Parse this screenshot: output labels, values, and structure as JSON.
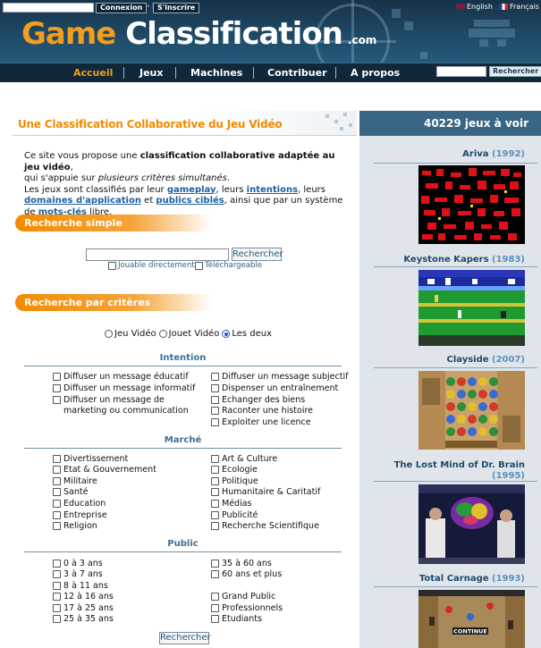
{
  "header": {
    "login_button": "Connexion",
    "signup_button": "S'inscrire",
    "separator": "-",
    "logo_game": "Game",
    "logo_classification": "Classification",
    "logo_com": ".com",
    "lang_en": "English",
    "lang_fr": "Français",
    "search_button": "Rechercher"
  },
  "nav": {
    "items": [
      "Accueil",
      "Jeux",
      "Machines",
      "Contribuer",
      "A propos"
    ]
  },
  "main": {
    "title": "Une Classification Collaborative du Jeu Vidéo",
    "intro": {
      "p1a": "Ce site vous propose une ",
      "p1b": "classification collaborative adaptée au jeu vidéo",
      "p1c": ",",
      "p1d": "qui s'appuie sur ",
      "p1e": "plusieurs critères simultanés",
      "p1f": ".",
      "p2a": "Les jeux sont classifiés par leur ",
      "link_gameplay": "gameplay",
      "p2b": ", leurs ",
      "link_intentions": "intentions",
      "p2c": ", leurs ",
      "link_domaines": "domaines d'application",
      "p2d": " et ",
      "link_publics": "publics ciblés",
      "p2e": ", ainsi que par un système de ",
      "link_motscles": "mots-clés",
      "p2f": " libre."
    },
    "simple_search": {
      "heading": "Recherche simple",
      "button": "Rechercher",
      "opt_jouable": "Jouable directement",
      "opt_telechargeable": "Téléchargeable"
    },
    "criteria_search": {
      "heading": "Recherche par critères",
      "type_options": [
        "Jeu Vidéo",
        "Jouet Vidéo",
        "Les deux"
      ],
      "type_selected": "Les deux",
      "button": "Rechercher",
      "intention": {
        "title": "Intention",
        "left": [
          "Diffuser un message éducatif",
          "Diffuser un message informatif",
          "Diffuser un message de marketing ou communication"
        ],
        "right": [
          "Diffuser un message subjectif",
          "Dispenser un entraînement",
          "Echanger des biens",
          "Raconter une histoire",
          "Exploiter une licence"
        ]
      },
      "marche": {
        "title": "Marché",
        "left": [
          "Divertissement",
          "Etat & Gouvernement",
          "Militaire",
          "Santé",
          "Education",
          "Entreprise",
          "Religion"
        ],
        "right": [
          "Art & Culture",
          "Ecologie",
          "Politique",
          "Humanitaire & Caritatif",
          "Médias",
          "Publicité",
          "Recherche Scientifique"
        ]
      },
      "public": {
        "title": "Public",
        "left": [
          "0 à 3 ans",
          "3 à 7 ans",
          "8 à 11 ans",
          "12 à 16 ans",
          "17 à 25 ans",
          "25 à 35 ans"
        ],
        "right": [
          "35 à 60 ans",
          "60 ans et plus",
          "Grand Public",
          "Professionnels",
          "Etudiants"
        ]
      }
    }
  },
  "sidebar": {
    "header": "40229 jeux à voir",
    "games": [
      {
        "name": "Ariva",
        "year": "(1992)"
      },
      {
        "name": "Keystone Kapers",
        "year": "(1983)"
      },
      {
        "name": "Clayside",
        "year": "(2007)"
      },
      {
        "name": "The Lost Mind of Dr. Brain",
        "year": "(1995)"
      },
      {
        "name": "Total Carnage",
        "year": "(1993)"
      }
    ],
    "total_carnage_overlay": "CONTINUE"
  },
  "colors": {
    "accent_orange": "#f28a00",
    "header_dark": "#163247",
    "sidebar_bg": "#dfe5ea",
    "link_blue": "#1d5fa0"
  }
}
